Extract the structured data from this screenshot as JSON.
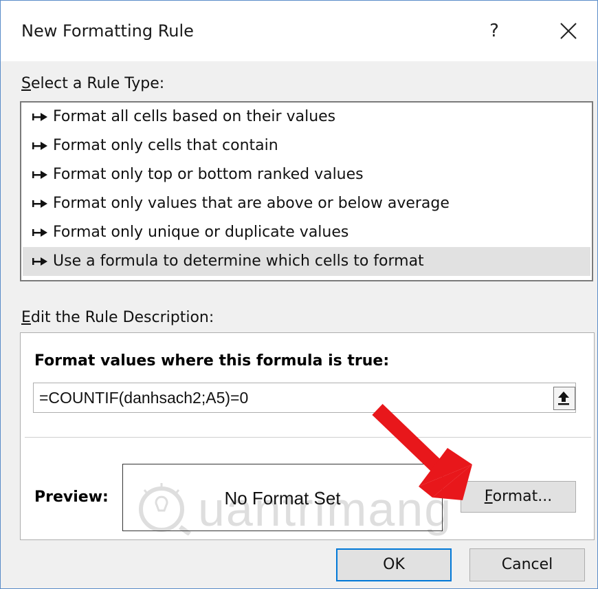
{
  "window": {
    "title": "New Formatting Rule",
    "help_label": "?",
    "close_icon": "close-icon"
  },
  "rule_type": {
    "label": "Select a Rule Type:",
    "items": [
      {
        "label": "Format all cells based on their values",
        "selected": false
      },
      {
        "label": "Format only cells that contain",
        "selected": false
      },
      {
        "label": "Format only top or bottom ranked values",
        "selected": false
      },
      {
        "label": "Format only values that are above or below average",
        "selected": false
      },
      {
        "label": "Format only unique or duplicate values",
        "selected": false
      },
      {
        "label": "Use a formula to determine which cells to format",
        "selected": true
      }
    ]
  },
  "description": {
    "label": "Edit the Rule Description:",
    "heading": "Format values where this formula is true:",
    "formula_value": "=COUNTIF(danhsach2;A5)=0",
    "preview_label": "Preview:",
    "preview_text": "No Format Set",
    "format_button": "Format..."
  },
  "watermark": {
    "text": "uantrimang"
  },
  "footer": {
    "ok_label": "OK",
    "cancel_label": "Cancel"
  },
  "colors": {
    "accent_border": "#0078d7",
    "annotation_arrow": "#e8171b",
    "selected_row": "#e1e1e1"
  }
}
